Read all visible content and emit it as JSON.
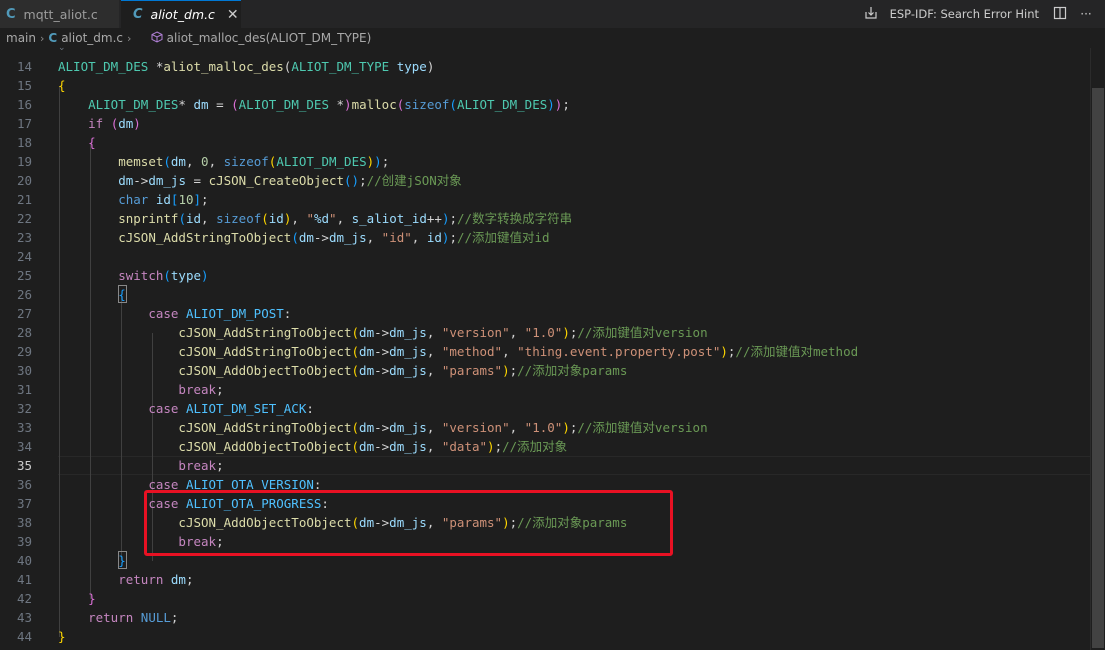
{
  "tabs": [
    {
      "icon": "C",
      "label": "mqtt_aliot.c"
    },
    {
      "icon": "C",
      "label": "aliot_dm.c"
    }
  ],
  "actions": {
    "hint": "ESP-IDF: Search Error Hint"
  },
  "breadcrumb": {
    "folder": "main",
    "file": "aliot_dm.c",
    "symbol": "aliot_malloc_des(ALIOT_DM_TYPE)"
  },
  "line_numbers": [
    "14",
    "15",
    "16",
    "17",
    "18",
    "19",
    "20",
    "21",
    "22",
    "23",
    "24",
    "25",
    "26",
    "27",
    "28",
    "29",
    "30",
    "31",
    "32",
    "33",
    "34",
    "35",
    "36",
    "37",
    "38",
    "39",
    "40",
    "41",
    "42",
    "43",
    "44"
  ],
  "active_line": "35",
  "code_lines": [
    [
      [
        "ty",
        "ALIOT_DM_DES"
      ],
      [
        "pl",
        " *"
      ],
      [
        "fn",
        "aliot_malloc_des"
      ],
      [
        "pl",
        "("
      ],
      [
        "ty",
        "ALIOT_DM_TYPE"
      ],
      [
        "pl",
        " "
      ],
      [
        "var",
        "type"
      ],
      [
        "pl",
        ")"
      ]
    ],
    [
      [
        "br1",
        "{"
      ]
    ],
    [
      [
        "pl",
        "    "
      ],
      [
        "ty",
        "ALIOT_DM_DES"
      ],
      [
        "pl",
        "* "
      ],
      [
        "var",
        "dm"
      ],
      [
        "pl",
        " = "
      ],
      [
        "br2",
        "("
      ],
      [
        "ty",
        "ALIOT_DM_DES"
      ],
      [
        "pl",
        " *"
      ],
      [
        "br2",
        ")"
      ],
      [
        "fn",
        "malloc"
      ],
      [
        "br2",
        "("
      ],
      [
        "kw",
        "sizeof"
      ],
      [
        "br3",
        "("
      ],
      [
        "ty",
        "ALIOT_DM_DES"
      ],
      [
        "br3",
        ")"
      ],
      [
        "br2",
        ")"
      ],
      [
        "pl",
        ";"
      ]
    ],
    [
      [
        "pl",
        "    "
      ],
      [
        "kwc",
        "if"
      ],
      [
        "pl",
        " "
      ],
      [
        "br2",
        "("
      ],
      [
        "var",
        "dm"
      ],
      [
        "br2",
        ")"
      ]
    ],
    [
      [
        "pl",
        "    "
      ],
      [
        "br2",
        "{"
      ]
    ],
    [
      [
        "pl",
        "        "
      ],
      [
        "fn",
        "memset"
      ],
      [
        "br3",
        "("
      ],
      [
        "var",
        "dm"
      ],
      [
        "pl",
        ", "
      ],
      [
        "num",
        "0"
      ],
      [
        "pl",
        ", "
      ],
      [
        "kw",
        "sizeof"
      ],
      [
        "br1",
        "("
      ],
      [
        "ty",
        "ALIOT_DM_DES"
      ],
      [
        "br1",
        ")"
      ],
      [
        "br3",
        ")"
      ],
      [
        "pl",
        ";"
      ]
    ],
    [
      [
        "pl",
        "        "
      ],
      [
        "var",
        "dm"
      ],
      [
        "pl",
        "->"
      ],
      [
        "var",
        "dm_js"
      ],
      [
        "pl",
        " = "
      ],
      [
        "fn",
        "cJSON_CreateObject"
      ],
      [
        "br3",
        "()"
      ],
      [
        "pl",
        ";"
      ],
      [
        "cm",
        "//创建jSON对象"
      ]
    ],
    [
      [
        "pl",
        "        "
      ],
      [
        "kw",
        "char"
      ],
      [
        "pl",
        " "
      ],
      [
        "var",
        "id"
      ],
      [
        "br3",
        "["
      ],
      [
        "num",
        "10"
      ],
      [
        "br3",
        "]"
      ],
      [
        "pl",
        ";"
      ]
    ],
    [
      [
        "pl",
        "        "
      ],
      [
        "fn",
        "snprintf"
      ],
      [
        "br3",
        "("
      ],
      [
        "var",
        "id"
      ],
      [
        "pl",
        ", "
      ],
      [
        "kw",
        "sizeof"
      ],
      [
        "br1",
        "("
      ],
      [
        "var",
        "id"
      ],
      [
        "br1",
        ")"
      ],
      [
        "pl",
        ", "
      ],
      [
        "str",
        "\""
      ],
      [
        "var",
        "%d"
      ],
      [
        "str",
        "\""
      ],
      [
        "pl",
        ", "
      ],
      [
        "var",
        "s_aliot_id"
      ],
      [
        "pl",
        "++"
      ],
      [
        "br3",
        ")"
      ],
      [
        "pl",
        ";"
      ],
      [
        "cm",
        "//数字转换成字符串"
      ]
    ],
    [
      [
        "pl",
        "        "
      ],
      [
        "fn",
        "cJSON_AddStringToObject"
      ],
      [
        "br3",
        "("
      ],
      [
        "var",
        "dm"
      ],
      [
        "pl",
        "->"
      ],
      [
        "var",
        "dm_js"
      ],
      [
        "pl",
        ", "
      ],
      [
        "str",
        "\"id\""
      ],
      [
        "pl",
        ", "
      ],
      [
        "var",
        "id"
      ],
      [
        "br3",
        ")"
      ],
      [
        "pl",
        ";"
      ],
      [
        "cm",
        "//添加键值对id"
      ]
    ],
    [],
    [
      [
        "pl",
        "        "
      ],
      [
        "kwc",
        "switch"
      ],
      [
        "br3",
        "("
      ],
      [
        "var",
        "type"
      ],
      [
        "br3",
        ")"
      ]
    ],
    [
      [
        "pl",
        "        "
      ],
      [
        "br3",
        "{"
      ]
    ],
    [
      [
        "pl",
        "            "
      ],
      [
        "kwc",
        "case"
      ],
      [
        "pl",
        " "
      ],
      [
        "mac",
        "ALIOT_DM_POST"
      ],
      [
        "pl",
        ":"
      ]
    ],
    [
      [
        "pl",
        "                "
      ],
      [
        "fn",
        "cJSON_AddStringToObject"
      ],
      [
        "br1",
        "("
      ],
      [
        "var",
        "dm"
      ],
      [
        "pl",
        "->"
      ],
      [
        "var",
        "dm_js"
      ],
      [
        "pl",
        ", "
      ],
      [
        "str",
        "\"version\""
      ],
      [
        "pl",
        ", "
      ],
      [
        "str",
        "\"1.0\""
      ],
      [
        "br1",
        ")"
      ],
      [
        "pl",
        ";"
      ],
      [
        "cm",
        "//添加键值对version"
      ]
    ],
    [
      [
        "pl",
        "                "
      ],
      [
        "fn",
        "cJSON_AddStringToObject"
      ],
      [
        "br1",
        "("
      ],
      [
        "var",
        "dm"
      ],
      [
        "pl",
        "->"
      ],
      [
        "var",
        "dm_js"
      ],
      [
        "pl",
        ", "
      ],
      [
        "str",
        "\"method\""
      ],
      [
        "pl",
        ", "
      ],
      [
        "str",
        "\"thing.event.property.post\""
      ],
      [
        "br1",
        ")"
      ],
      [
        "pl",
        ";"
      ],
      [
        "cm",
        "//添加键值对method"
      ]
    ],
    [
      [
        "pl",
        "                "
      ],
      [
        "fn",
        "cJSON_AddObjectToObject"
      ],
      [
        "br1",
        "("
      ],
      [
        "var",
        "dm"
      ],
      [
        "pl",
        "->"
      ],
      [
        "var",
        "dm_js"
      ],
      [
        "pl",
        ", "
      ],
      [
        "str",
        "\"params\""
      ],
      [
        "br1",
        ")"
      ],
      [
        "pl",
        ";"
      ],
      [
        "cm",
        "//添加对象params"
      ]
    ],
    [
      [
        "pl",
        "                "
      ],
      [
        "kwc",
        "break"
      ],
      [
        "pl",
        ";"
      ]
    ],
    [
      [
        "pl",
        "            "
      ],
      [
        "kwc",
        "case"
      ],
      [
        "pl",
        " "
      ],
      [
        "mac",
        "ALIOT_DM_SET_ACK"
      ],
      [
        "pl",
        ":"
      ]
    ],
    [
      [
        "pl",
        "                "
      ],
      [
        "fn",
        "cJSON_AddStringToObject"
      ],
      [
        "br1",
        "("
      ],
      [
        "var",
        "dm"
      ],
      [
        "pl",
        "->"
      ],
      [
        "var",
        "dm_js"
      ],
      [
        "pl",
        ", "
      ],
      [
        "str",
        "\"version\""
      ],
      [
        "pl",
        ", "
      ],
      [
        "str",
        "\"1.0\""
      ],
      [
        "br1",
        ")"
      ],
      [
        "pl",
        ";"
      ],
      [
        "cm",
        "//添加键值对version"
      ]
    ],
    [
      [
        "pl",
        "                "
      ],
      [
        "fn",
        "cJSON_AddObjectToObject"
      ],
      [
        "br1",
        "("
      ],
      [
        "var",
        "dm"
      ],
      [
        "pl",
        "->"
      ],
      [
        "var",
        "dm_js"
      ],
      [
        "pl",
        ", "
      ],
      [
        "str",
        "\"data\""
      ],
      [
        "br1",
        ")"
      ],
      [
        "pl",
        ";"
      ],
      [
        "cm",
        "//添加对象"
      ]
    ],
    [
      [
        "pl",
        "                "
      ],
      [
        "kwc",
        "break"
      ],
      [
        "pl",
        ";"
      ]
    ],
    [
      [
        "pl",
        "            "
      ],
      [
        "kwc",
        "case"
      ],
      [
        "pl",
        " "
      ],
      [
        "mac",
        "ALIOT_OTA_VERSION"
      ],
      [
        "pl",
        ":"
      ]
    ],
    [
      [
        "pl",
        "            "
      ],
      [
        "kwc",
        "case"
      ],
      [
        "pl",
        " "
      ],
      [
        "mac",
        "ALIOT_OTA_PROGRESS"
      ],
      [
        "pl",
        ":"
      ]
    ],
    [
      [
        "pl",
        "                "
      ],
      [
        "fn",
        "cJSON_AddObjectToObject"
      ],
      [
        "br1",
        "("
      ],
      [
        "var",
        "dm"
      ],
      [
        "pl",
        "->"
      ],
      [
        "var",
        "dm_js"
      ],
      [
        "pl",
        ", "
      ],
      [
        "str",
        "\"params\""
      ],
      [
        "br1",
        ")"
      ],
      [
        "pl",
        ";"
      ],
      [
        "cm",
        "//添加对象params"
      ]
    ],
    [
      [
        "pl",
        "                "
      ],
      [
        "kwc",
        "break"
      ],
      [
        "pl",
        ";"
      ]
    ],
    [
      [
        "pl",
        "        "
      ],
      [
        "br3",
        "}"
      ]
    ],
    [
      [
        "pl",
        "        "
      ],
      [
        "kwc",
        "return"
      ],
      [
        "pl",
        " "
      ],
      [
        "var",
        "dm"
      ],
      [
        "pl",
        ";"
      ]
    ],
    [
      [
        "pl",
        "    "
      ],
      [
        "br2",
        "}"
      ]
    ],
    [
      [
        "pl",
        "    "
      ],
      [
        "kwc",
        "return"
      ],
      [
        "pl",
        " "
      ],
      [
        "kw",
        "NULL"
      ],
      [
        "pl",
        ";"
      ]
    ],
    [
      [
        "br1",
        "}"
      ]
    ]
  ]
}
